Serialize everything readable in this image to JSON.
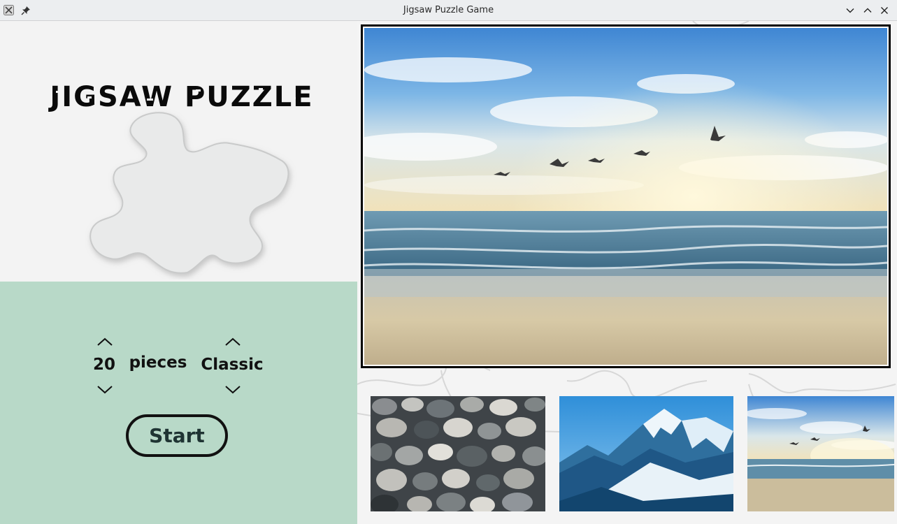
{
  "window": {
    "title": "Jigsaw Puzzle Game"
  },
  "header": {
    "logo_text": "JIGSAW PUZZLE"
  },
  "controls": {
    "piece_count": "20",
    "pieces_label": "pieces",
    "mode": "Classic",
    "start_label": "Start"
  },
  "preview": {
    "image": "beach-sunset-with-seagulls"
  },
  "thumbnails": [
    {
      "image": "pebbles"
    },
    {
      "image": "snowy-mountains"
    },
    {
      "image": "beach-sunset-with-seagulls"
    }
  ],
  "colors": {
    "panel_green": "#b8d9c8",
    "border": "#000000",
    "start_text": "#1f3433"
  },
  "icons": {
    "app": "x-app-icon",
    "pin": "pin-icon",
    "minimize": "chevron-down-icon",
    "maximize": "chevron-up-icon",
    "close": "close-icon",
    "increase": "chevron-up-icon",
    "decrease": "chevron-down-icon"
  }
}
